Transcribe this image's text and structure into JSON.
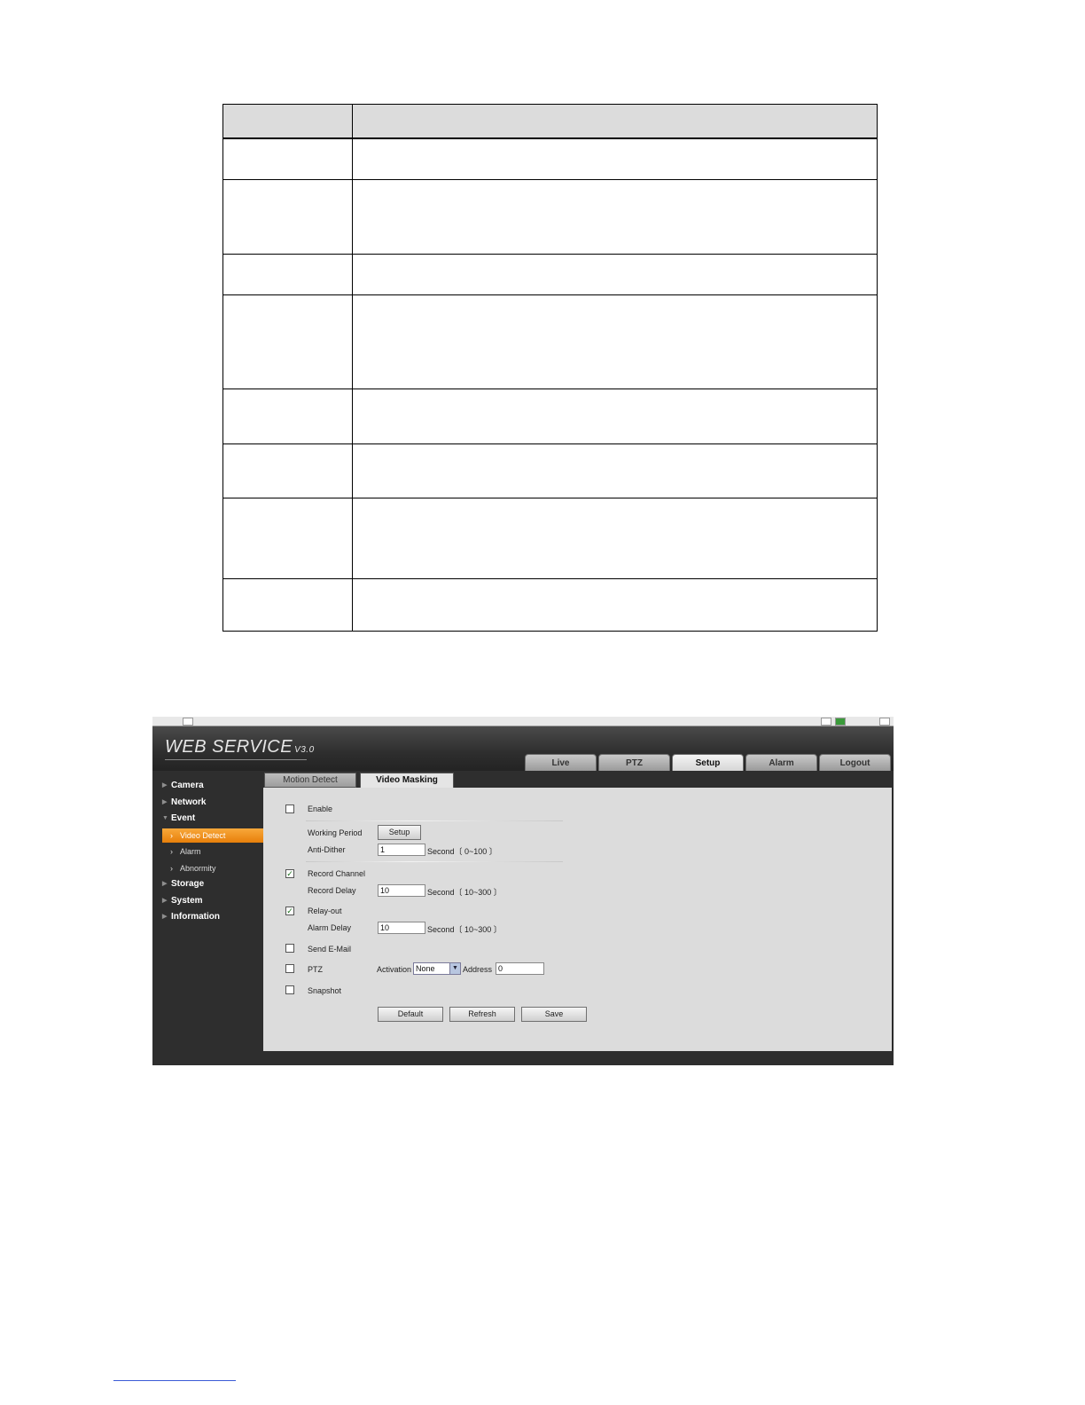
{
  "document": {
    "table": {
      "rows": 9
    }
  },
  "screenshot": {
    "logo": {
      "text": "WEB  SERVICE",
      "version": "V3.0"
    },
    "top_nav": [
      "Live",
      "PTZ",
      "Setup",
      "Alarm",
      "Logout"
    ],
    "top_nav_active": "Setup",
    "sidebar": {
      "camera": "Camera",
      "network": "Network",
      "event": "Event",
      "video_detect": "Video Detect",
      "alarm": "Alarm",
      "abnormity": "Abnormity",
      "storage": "Storage",
      "system": "System",
      "information": "Information"
    },
    "tabs": {
      "motion_detect": "Motion Detect",
      "video_masking": "Video Masking"
    },
    "form": {
      "enable_label": "Enable",
      "enable_checked": false,
      "working_period_label": "Working Period",
      "setup_button": "Setup",
      "anti_dither_label": "Anti-Dither",
      "anti_dither_value": "1",
      "anti_dither_range": "Second〔 0~100 〕",
      "record_channel_label": "Record Channel",
      "record_channel_checked": true,
      "record_delay_label": "Record Delay",
      "record_delay_value": "10",
      "record_delay_range": "Second〔 10~300 〕",
      "relay_out_label": "Relay-out",
      "relay_out_checked": true,
      "alarm_delay_label": "Alarm Delay",
      "alarm_delay_value": "10",
      "alarm_delay_range": "Second〔 10~300 〕",
      "send_email_label": "Send E-Mail",
      "ptz_label": "PTZ",
      "activation_label": "Activation",
      "activation_value": "None",
      "address_label": "Address",
      "address_value": "0",
      "snapshot_label": "Snapshot",
      "default_button": "Default",
      "refresh_button": "Refresh",
      "save_button": "Save"
    }
  }
}
